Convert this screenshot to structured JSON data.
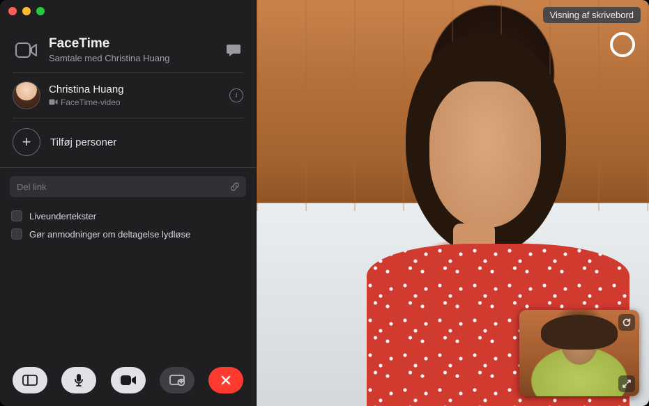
{
  "header": {
    "app_title": "FaceTime",
    "subtitle": "Samtale med Christina Huang"
  },
  "participant": {
    "name": "Christina Huang",
    "subtitle": "FaceTime-video"
  },
  "add_people_label": "Tilføj personer",
  "share_link": {
    "placeholder": "Del link"
  },
  "options": {
    "live_captions": "Liveundertekster",
    "mute_requests": "Gør anmodninger om deltagelse lydløse"
  },
  "badge_desktop_view": "Visning af skrivebord",
  "icons": {
    "video": "video-icon",
    "message": "message-icon",
    "info": "info-icon",
    "plus": "plus-icon",
    "link": "link-icon",
    "sidebar": "sidebar-icon",
    "mic": "mic-icon",
    "camera": "camera-icon",
    "screen_share": "screen-share-icon",
    "end_call": "end-call-icon",
    "live": "live-photo-icon",
    "refresh": "refresh-icon",
    "expand": "expand-icon"
  },
  "colors": {
    "end_call": "#ff3b30",
    "sidebar_bg": "#1f1f21"
  }
}
